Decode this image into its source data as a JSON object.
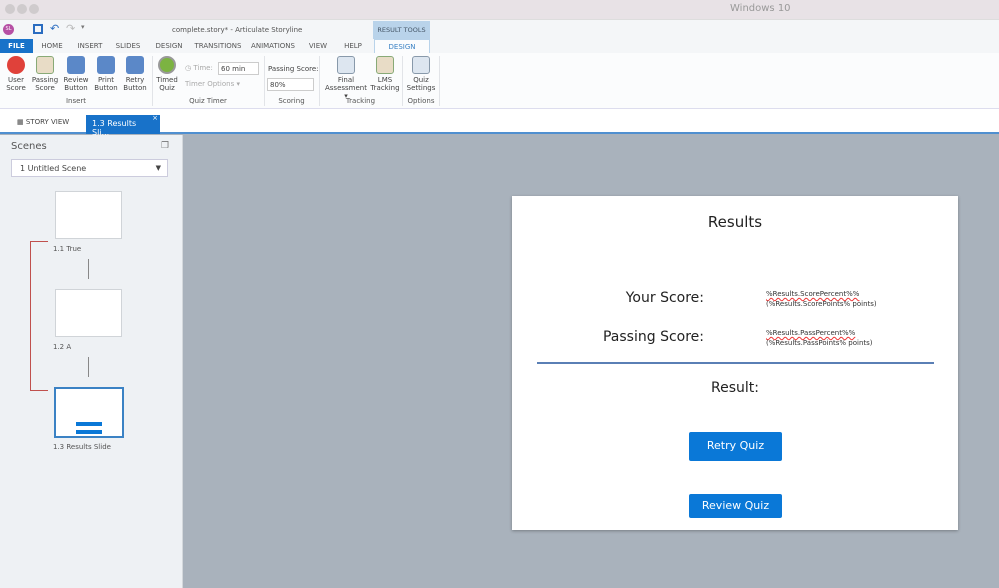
{
  "os_title": "Windows 10",
  "app": {
    "title": "complete.story* -  Articulate Storyline",
    "contextual_group": "RESULT TOOLS",
    "logo": "SL"
  },
  "tabs": [
    "FILE",
    "HOME",
    "INSERT",
    "SLIDES",
    "DESIGN",
    "TRANSITIONS",
    "ANIMATIONS",
    "VIEW",
    "HELP",
    "DESIGN"
  ],
  "ribbon": {
    "insert": {
      "label": "Insert",
      "buttons": [
        "User Score",
        "Passing Score",
        "Review Button",
        "Print Button",
        "Retry Button"
      ]
    },
    "quiz_timer": {
      "label": "Quiz Timer",
      "timed_quiz": "Timed Quiz",
      "time_label": "Time:",
      "time_value": "60 min",
      "timer_options": "Timer Options"
    },
    "scoring": {
      "label": "Scoring",
      "passing_label": "Passing Score:",
      "passing_value": "80%"
    },
    "tracking": {
      "label": "Tracking",
      "buttons": [
        "Final Assessment",
        "LMS Tracking"
      ]
    },
    "options": {
      "label": "Options",
      "buttons": [
        "Quiz Settings"
      ]
    }
  },
  "doc_tabs": {
    "story_view": "STORY VIEW",
    "active": "1.3 Results Sli..."
  },
  "scenes": {
    "title": "Scenes",
    "selected": "1 Untitled Scene",
    "slides": [
      "1.1 True",
      "1.2 A",
      "1.3 Results Slide"
    ]
  },
  "slide": {
    "title": "Results",
    "your_score": "Your Score:",
    "passing_score": "Passing Score:",
    "score_var1": "%Results.ScorePercent%%",
    "score_var2": "(%Results.ScorePoints% points)",
    "pass_var1": "%Results.PassPercent%%",
    "pass_var2": "(%Results.PassPoints% points)",
    "result": "Result:",
    "retry": "Retry Quiz",
    "review": "Review Quiz"
  }
}
